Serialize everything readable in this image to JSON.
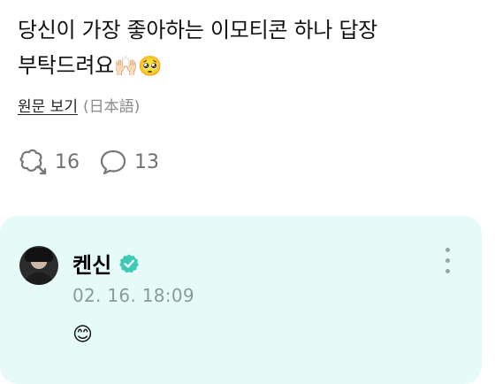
{
  "post": {
    "text_line1": "당신이 가장 좋아하는 이모티콘 하나 답장",
    "text_line2": "부탁드려요",
    "text_emojis": "🙌🏻🥺",
    "translate_link": "원문 보기",
    "translate_lang": "(日本語)"
  },
  "stats": {
    "reposts_icon": "repost-icon",
    "reposts_count": "16",
    "comments_icon": "comment-icon",
    "comments_count": "13"
  },
  "reply": {
    "author": "켄신",
    "verified_icon": "verified-badge-icon",
    "timestamp": "02. 16. 18:09",
    "body": "😊",
    "more_icon": "more-vertical-icon"
  },
  "colors": {
    "reply_background": "#e6faf7",
    "verified": "#3cc9b6",
    "muted_text": "#8a9a98"
  }
}
